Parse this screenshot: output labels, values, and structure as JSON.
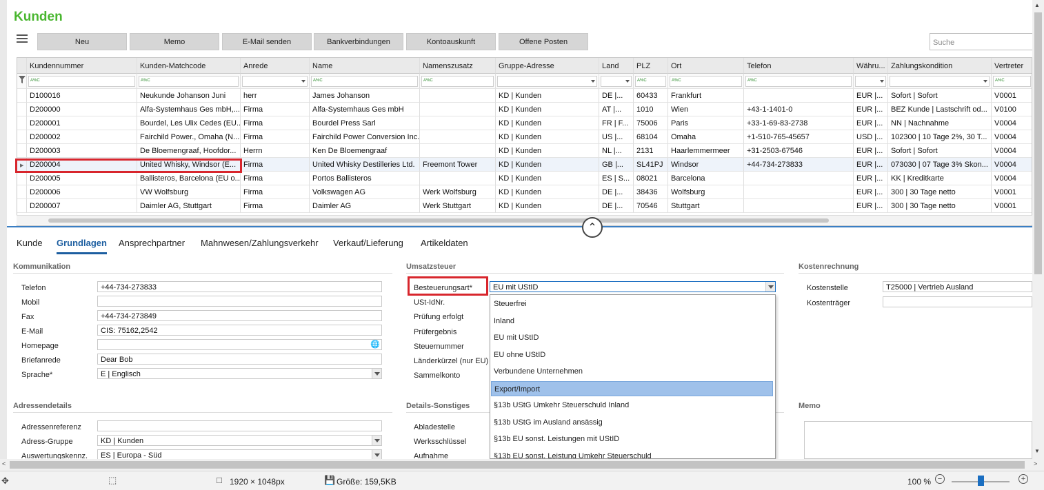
{
  "app": {
    "title": "Kunden"
  },
  "toolbar": {
    "buttons": [
      "Neu",
      "Memo",
      "E-Mail senden",
      "Bankverbindungen",
      "Kontoauskunft",
      "Offene Posten"
    ],
    "search_placeholder": "Suche"
  },
  "grid": {
    "columns": [
      "Kundennummer",
      "Kunden-Matchcode",
      "Anrede",
      "Name",
      "Namenszusatz",
      "Gruppe-Adresse",
      "Land",
      "PLZ",
      "Ort",
      "Telefon",
      "Währu...",
      "Zahlungskondition",
      "Vertreter"
    ],
    "filter_hint": "A%C",
    "rows": [
      [
        "D100016",
        "Neukunde Johanson Juni",
        "herr",
        "James Johanson",
        "",
        "KD  |  Kunden",
        "DE  |...",
        "60433",
        "Frankfurt",
        "",
        "EUR  |...",
        "Sofort  |  Sofort",
        "V0001"
      ],
      [
        "D200000",
        "Alfa-Systemhaus Ges mbH,...",
        "Firma",
        "Alfa-Systemhaus Ges mbH",
        "",
        "KD  |  Kunden",
        "AT  |...",
        "1010",
        "Wien",
        "+43-1-1401-0",
        "EUR  |...",
        "BEZ Kunde  |  Lastschrift od...",
        "V0100"
      ],
      [
        "D200001",
        "Bourdel, Les Ulix Cedes (EU...",
        "Firma",
        "Bourdel Press Sarl",
        "",
        "KD  |  Kunden",
        "FR  |  F...",
        "75006",
        "Paris",
        "+33-1-69-83-2738",
        "EUR  |...",
        "NN  |  Nachnahme",
        "V0004"
      ],
      [
        "D200002",
        "Fairchild Power., Omaha (N...",
        "Firma",
        "Fairchild Power Conversion Inc.",
        "",
        "KD  |  Kunden",
        "US  |...",
        "68104",
        "Omaha",
        "+1-510-765-45657",
        "USD  |...",
        "102300  |  10 Tage 2%, 30 T...",
        "V0004"
      ],
      [
        "D200003",
        "De Bloemengraaf, Hoofdor...",
        "Herrn",
        "Ken De Bloemengraaf",
        "",
        "KD  |  Kunden",
        "NL  |...",
        "2131",
        "Haarlemmermeer",
        "+31-2503-67546",
        "EUR  |...",
        "Sofort  |  Sofort",
        "V0004"
      ],
      [
        "D200004",
        "United Whisky, Windsor (E...",
        "Firma",
        "United Whisky Destilleries Ltd.",
        "Freemont Tower",
        "KD  |  Kunden",
        "GB  |...",
        "SL41PJ",
        "Windsor",
        "+44-734-273833",
        "EUR  |...",
        "073030  |  07 Tage 3% Skon...",
        "V0004"
      ],
      [
        "D200005",
        "Ballisteros, Barcelona (EU o...",
        "Firma",
        "Portos Ballisteros",
        "",
        "KD  |  Kunden",
        "ES  |  S...",
        "08021",
        "Barcelona",
        "",
        "EUR  |...",
        "KK  |  Kreditkarte",
        "V0004"
      ],
      [
        "D200006",
        "VW Wolfsburg",
        "Firma",
        "Volkswagen AG",
        "Werk Wolfsburg",
        "KD  |  Kunden",
        "DE  |...",
        "38436",
        "Wolfsburg",
        "",
        "EUR  |...",
        "300  |  30 Tage netto",
        "V0001"
      ],
      [
        "D200007",
        "Daimler AG, Stuttgart",
        "Firma",
        "Daimler AG",
        "Werk Stuttgart",
        "KD  |  Kunden",
        "DE  |...",
        "70546",
        "Stuttgart",
        "",
        "EUR  |...",
        "300  |  30 Tage netto",
        "V0001"
      ]
    ]
  },
  "tabs": [
    "Kunde",
    "Grundlagen",
    "Ansprechpartner",
    "Mahnwesen/Zahlungsverkehr",
    "Verkauf/Lieferung",
    "Artikeldaten"
  ],
  "kommunikation": {
    "title": "Kommunikation",
    "fields": [
      {
        "label": "Telefon",
        "value": "+44-734-273833"
      },
      {
        "label": "Mobil",
        "value": ""
      },
      {
        "label": "Fax",
        "value": "+44-734-273849"
      },
      {
        "label": "E-Mail",
        "value": "CIS: 75162,2542"
      },
      {
        "label": "Homepage",
        "value": ""
      },
      {
        "label": "Briefanrede",
        "value": "Dear Bob"
      },
      {
        "label": "Sprache*",
        "value": "E  |  Englisch"
      }
    ]
  },
  "adressendetails": {
    "title": "Adressendetails",
    "fields": [
      {
        "label": "Adressenreferenz",
        "value": ""
      },
      {
        "label": "Adress-Gruppe",
        "value": "KD  |  Kunden"
      },
      {
        "label": "Auswertungskennz.",
        "value": "ES  |  Europa - Süd"
      }
    ]
  },
  "umsatzsteuer": {
    "title": "Umsatzsteuer",
    "besteuerungsart_label": "Besteuerungsart*",
    "besteuerungsart_value": "EU mit UStID",
    "labels": [
      "USt-IdNr.",
      "Prüfung erfolgt",
      "Prüfergebnis",
      "Steuernummer",
      "Länderkürzel (nur EU)",
      "Sammelkonto"
    ]
  },
  "dropdown_options": [
    "Steuerfrei",
    "Inland",
    "EU mit UStID",
    "EU ohne UStID",
    "Verbundene Unternehmen",
    "Export/Import",
    "§13b UStG Umkehr Steuerschuld Inland",
    "§13b UStG im Ausland ansässig",
    "§13b EU sonst. Leistungen mit UStID",
    "§13b EU sonst. Leistung Umkehr Steuerschuld"
  ],
  "details_sonstiges": {
    "title": "Details-Sonstiges",
    "labels": [
      "Abladestelle",
      "Werksschlüssel",
      "Aufnahme"
    ]
  },
  "kostenrechnung": {
    "title": "Kostenrechnung",
    "kostenstelle_label": "Kostenstelle",
    "kostenstelle_value": "T25000  |  Vertrieb Ausland",
    "kostentraeger_label": "Kostenträger"
  },
  "memo": {
    "title": "Memo"
  },
  "statusbar": {
    "dimensions": "1920 × 1048px",
    "size": "Größe: 159,5KB",
    "zoom": "100 %",
    "zoom_level": 0.5
  }
}
